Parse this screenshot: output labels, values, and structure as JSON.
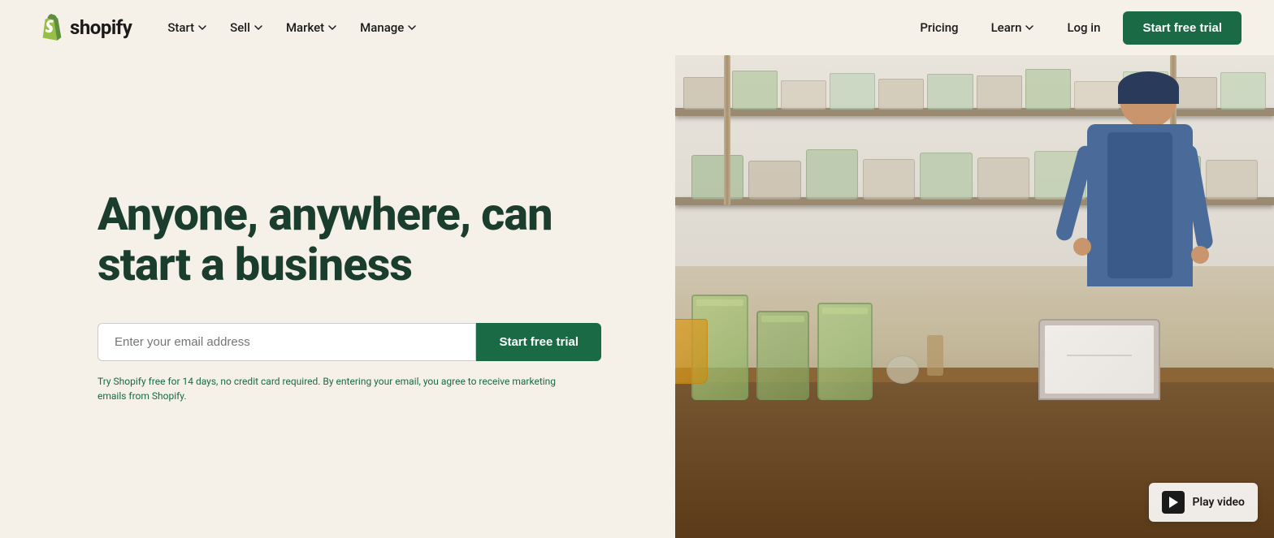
{
  "nav": {
    "logo_text": "shopify",
    "items": [
      {
        "label": "Start",
        "has_dropdown": true
      },
      {
        "label": "Sell",
        "has_dropdown": true
      },
      {
        "label": "Market",
        "has_dropdown": true
      },
      {
        "label": "Manage",
        "has_dropdown": true
      }
    ],
    "right_items": {
      "pricing": "Pricing",
      "learn": "Learn",
      "login": "Log in",
      "cta": "Start free trial"
    }
  },
  "hero": {
    "title_line1": "Anyone, anywhere, can",
    "title_line2": "start a business",
    "email_placeholder": "Enter your email address",
    "cta_button": "Start free trial",
    "fine_print": "Try Shopify free for 14 days, no credit card required. By entering your email, you agree to receive marketing emails from Shopify."
  },
  "video_btn": {
    "label": "Play video"
  },
  "colors": {
    "bg": "#f5f0e8",
    "title": "#1a3d2e",
    "cta_bg": "#1a6b45",
    "fine_print": "#1a6b45"
  }
}
